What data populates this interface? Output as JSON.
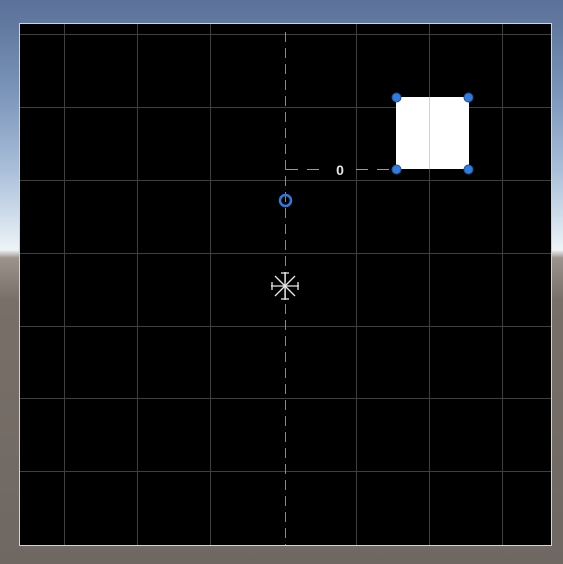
{
  "scene": {
    "offset_label": "0",
    "colors": {
      "canvas_background": "#000000",
      "grid_line": "#4a4a4a",
      "handle": "#2f7be0",
      "sprite": "#ffffff"
    }
  }
}
